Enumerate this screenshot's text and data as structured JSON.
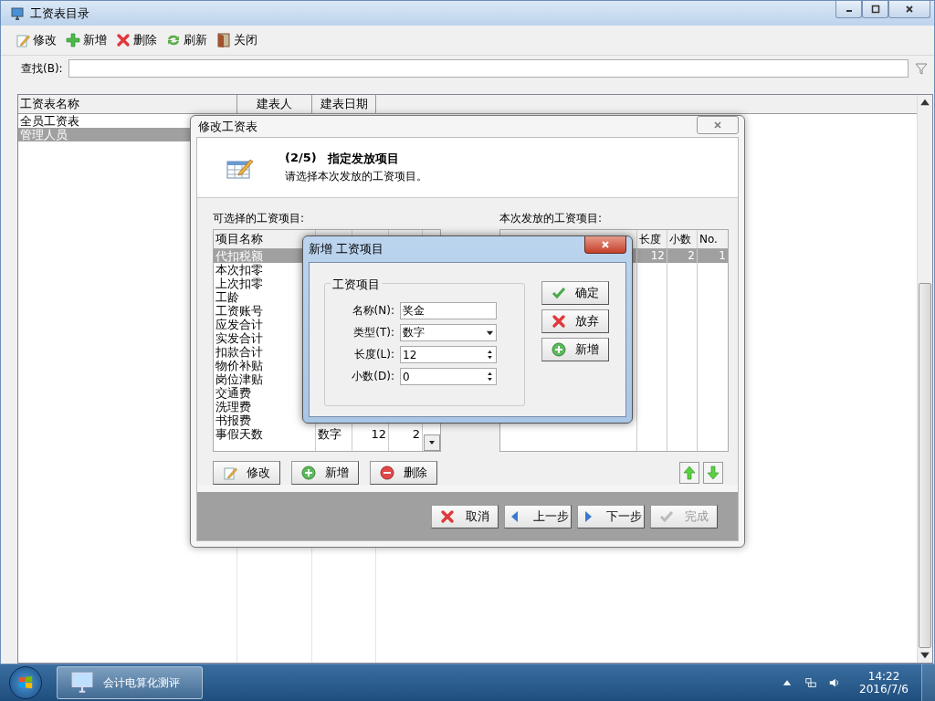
{
  "window": {
    "title": "工资表目录"
  },
  "toolbar": [
    {
      "label": "修改",
      "kind": "edit"
    },
    {
      "label": "新增",
      "kind": "add"
    },
    {
      "label": "删除",
      "kind": "delete"
    },
    {
      "label": "刷新",
      "kind": "refresh"
    },
    {
      "label": "关闭",
      "kind": "close"
    }
  ],
  "search": {
    "label": "查找(B):"
  },
  "table": {
    "columns": [
      "工资表名称",
      "建表人",
      "建表日期"
    ],
    "rows": [
      {
        "name": "全员工资表",
        "selected": false
      },
      {
        "name": "管理人员",
        "selected": true
      }
    ]
  },
  "wizard": {
    "title": "修改工资表",
    "step": "(2/5)",
    "heading": "指定发放项目",
    "subtitle": "请选择本次发放的工资项目。",
    "available_label": "可选择的工资项目:",
    "available_columns": [
      "项目名称"
    ],
    "available_rows": [
      {
        "name": "代扣税额",
        "selected": true
      },
      {
        "name": "本次扣零",
        "selected": false
      },
      {
        "name": "上次扣零",
        "selected": false
      },
      {
        "name": "工龄",
        "selected": false
      },
      {
        "name": "工资账号",
        "selected": false
      },
      {
        "name": "应发合计",
        "selected": false
      },
      {
        "name": "实发合计",
        "selected": false
      },
      {
        "name": "扣款合计",
        "selected": false
      },
      {
        "name": "物价补贴",
        "selected": false
      },
      {
        "name": "岗位津贴",
        "selected": false
      },
      {
        "name": "交通费",
        "selected": false
      },
      {
        "name": "洗理费",
        "selected": false
      },
      {
        "name": "书报费",
        "selected": false
      },
      {
        "name": "事假天数",
        "type": "数字",
        "length": "12",
        "decimals": "2",
        "selected": false
      }
    ],
    "chosen_label": "本次发放的工资项目:",
    "chosen_columns": [
      "长度",
      "小数",
      "No."
    ],
    "chosen_rows": [
      {
        "cells": [
          "12",
          "2",
          "1"
        ],
        "selected": true
      }
    ],
    "list_buttons": [
      {
        "label": "修改",
        "kind": "edit"
      },
      {
        "label": "新增",
        "kind": "add"
      },
      {
        "label": "删除",
        "kind": "remove"
      }
    ],
    "nav_buttons": [
      {
        "label": "取消",
        "kind": "cancel",
        "disabled": false
      },
      {
        "label": "上一步",
        "kind": "prev",
        "disabled": false
      },
      {
        "label": "下一步",
        "kind": "next",
        "disabled": false
      },
      {
        "label": "完成",
        "kind": "finish",
        "disabled": true
      }
    ]
  },
  "dialog": {
    "title": "新增 工资项目",
    "group": "工资项目",
    "fields": [
      {
        "label": "名称(N):",
        "value": "奖金",
        "kind": "text"
      },
      {
        "label": "类型(T):",
        "value": "数字",
        "kind": "select"
      },
      {
        "label": "长度(L):",
        "value": "12",
        "kind": "spin"
      },
      {
        "label": "小数(D):",
        "value": "0",
        "kind": "spin"
      }
    ],
    "buttons": [
      {
        "label": "确定",
        "kind": "ok"
      },
      {
        "label": "放弃",
        "kind": "cancel"
      },
      {
        "label": "新增",
        "kind": "add"
      }
    ]
  },
  "taskbar": {
    "app": "会计电算化测评",
    "time": "14:22",
    "date": "2016/7/6"
  }
}
